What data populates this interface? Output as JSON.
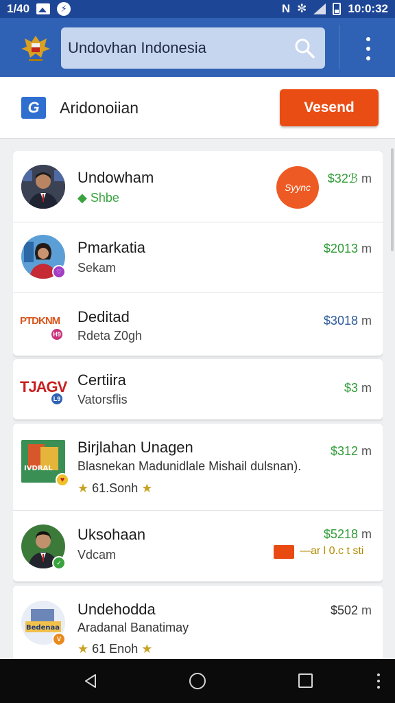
{
  "status_bar": {
    "left_text": "1/40",
    "time": "10:0:32",
    "icons": [
      "image-icon",
      "bolt-icon",
      "nfc-icon",
      "vibrate-icon",
      "signal-icon",
      "battery-icon"
    ]
  },
  "app_bar": {
    "search_value": "Undovhan Indonesia",
    "icons": [
      "emblem-icon",
      "search-icon",
      "more-vert-icon"
    ],
    "color": "#2f62b4"
  },
  "subheader": {
    "icon_letter": "G",
    "title": "Aridonoiian",
    "send_label": "Vesend",
    "accent": "#ea4d14"
  },
  "list": {
    "items": [
      {
        "name": "Undowham",
        "status": "◆ Shbe",
        "price": "$32ℬ",
        "unit": "m",
        "sync_label": "Syync"
      },
      {
        "name": "Pmarkatia",
        "subtitle": "Sekam",
        "price": "$2013",
        "unit": "m",
        "badge": "♡"
      },
      {
        "name": "Deditad",
        "subtitle": "Rdeta Z0gh",
        "price": "$3018",
        "unit": "m",
        "logo_text": "PTDKNM",
        "badge": "H9"
      },
      {
        "name": "Certiira",
        "subtitle": "Vatorsflis",
        "price": "$3",
        "unit": "m",
        "logo_text": "TJAGV",
        "badge": "L9"
      },
      {
        "name": "Birjlahan Unagen",
        "subtitle": "Blasnekan Madunidlale Mishail dulsnan).",
        "rating": "61.Sonh",
        "price": "$312",
        "unit": "m",
        "logo_text": "IVDRAL"
      },
      {
        "name": "Uksohaan",
        "subtitle": "Vdcam",
        "price": "$5218",
        "unit": "m",
        "tag_text": "—ar l 0.c t sti"
      },
      {
        "name": "Undehodda",
        "subtitle": "Aradanal Banatimay",
        "rating": "61 Enoh",
        "price": "$502",
        "unit": "m",
        "logo_text": "Bedenaa",
        "badge": "V"
      }
    ]
  },
  "nav_bar": {
    "icons": [
      "back-icon",
      "home-icon",
      "recents-icon",
      "more-icon"
    ]
  }
}
